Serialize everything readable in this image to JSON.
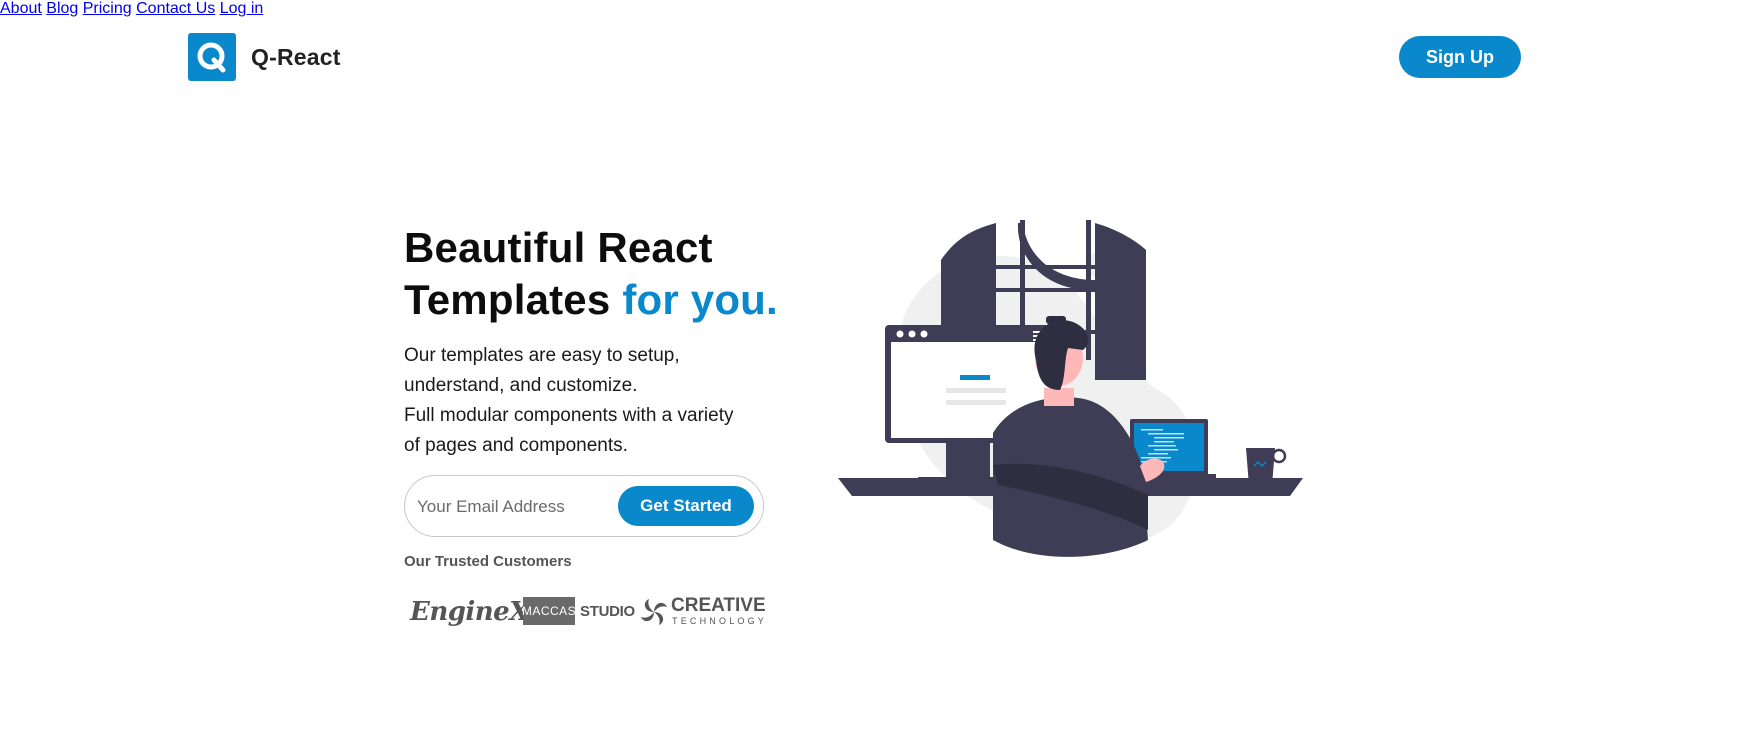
{
  "brand": {
    "logo_letter": "Q",
    "name": "Q-React",
    "color": "#0a88cc"
  },
  "nav": {
    "about": "About",
    "blog": "Blog",
    "pricing": "Pricing",
    "contact": "Contact Us",
    "login": "Log in",
    "signup": "Sign Up"
  },
  "hero": {
    "title_line1": "Beautiful React",
    "title_line2_prefix": "Templates",
    "title_line2_accent": "for you.",
    "description_line1": "Our templates are easy to setup,",
    "description_line2": "understand, and customize.",
    "description_line3": "Full modular components with a variety",
    "description_line4": "of pages and components.",
    "email_placeholder": "Your Email Address",
    "cta_label": "Get Started"
  },
  "customers": {
    "label": "Our Trusted Customers",
    "logos": [
      {
        "name": "EngineX"
      },
      {
        "box": "MACCAS",
        "text": "STUDIO"
      },
      {
        "main": "CREATIVE",
        "sub": "TECHNOLOGY"
      }
    ]
  },
  "illustration": {
    "icon": "developer-at-desk-illustration",
    "colors": {
      "dark": "#3f3d56",
      "accent": "#0a88cc",
      "skin": "#ffb8b8",
      "bg": "#f0f0f0"
    }
  }
}
